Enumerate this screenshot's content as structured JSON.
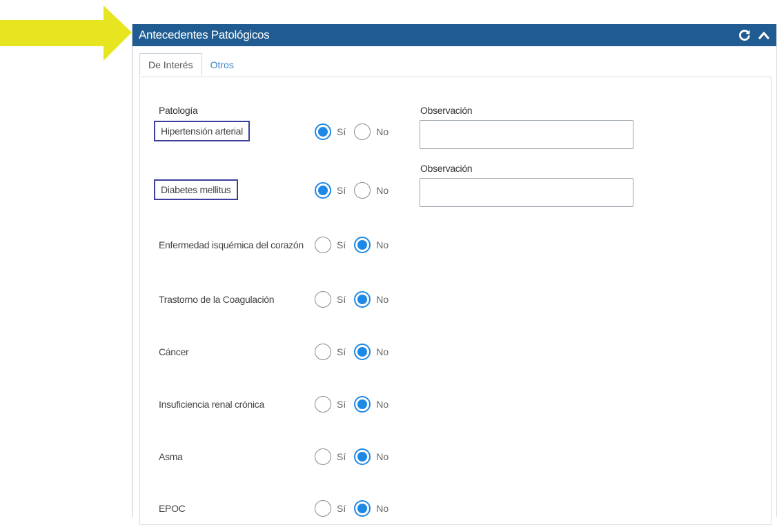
{
  "panel": {
    "title": "Antecedentes Patológicos",
    "refresh_icon": "refresh-icon",
    "collapse_icon": "chevron-up-icon",
    "header_color": "#205c91"
  },
  "annotation": {
    "arrow_color": "#e6e51f"
  },
  "tabs": [
    {
      "label": "De Interés",
      "active": true
    },
    {
      "label": "Otros",
      "active": false
    }
  ],
  "form": {
    "column_label": "Patología",
    "yes_label": "Sí",
    "no_label": "No",
    "observation_label": "Observación",
    "rows": [
      {
        "label": "Hipertensión arterial",
        "value": "Sí",
        "highlighted": true,
        "observation": ""
      },
      {
        "label": "Diabetes mellitus",
        "value": "Sí",
        "highlighted": true,
        "observation": ""
      },
      {
        "label": "Enfermedad isquémica del corazón",
        "value": "No"
      },
      {
        "label": "Trastorno de la Coagulación",
        "value": "No"
      },
      {
        "label": "Cáncer",
        "value": "No"
      },
      {
        "label": "Insuficiencia renal crónica",
        "value": "No"
      },
      {
        "label": "Asma",
        "value": "No"
      },
      {
        "label": "EPOC",
        "value": "No"
      }
    ]
  }
}
